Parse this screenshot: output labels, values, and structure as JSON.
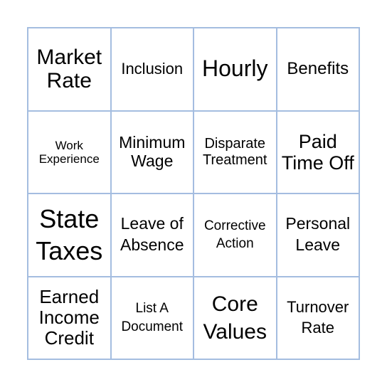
{
  "card": {
    "border_color": "#a4bde0",
    "cells": [
      "Market Rate",
      "Inclusion",
      "Hourly",
      "Benefits",
      "Work Experience",
      "Minimum Wage",
      "Disparate Treatment",
      "Paid Time Off",
      "State Taxes",
      "Leave of Absence",
      "Corrective Action",
      "Personal Leave",
      "Earned Income Credit",
      "List A Document",
      "Core Values",
      "Turnover Rate"
    ]
  }
}
